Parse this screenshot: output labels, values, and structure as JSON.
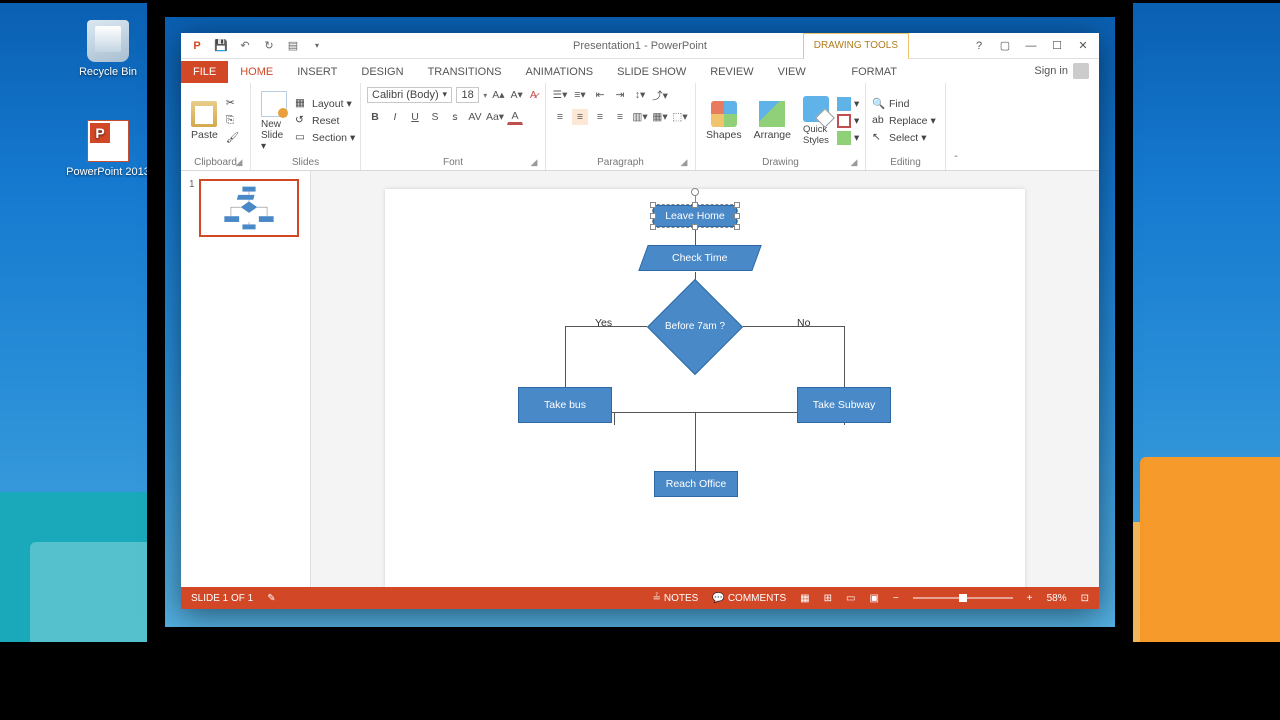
{
  "desktop": {
    "recycle": "Recycle Bin",
    "ppt": "PowerPoint 2013"
  },
  "titlebar": {
    "title": "Presentation1 - PowerPoint",
    "context": "DRAWING TOOLS",
    "signin": "Sign in"
  },
  "tabs": {
    "file": "FILE",
    "home": "HOME",
    "insert": "INSERT",
    "design": "DESIGN",
    "transitions": "TRANSITIONS",
    "animations": "ANIMATIONS",
    "slideshow": "SLIDE SHOW",
    "review": "REVIEW",
    "view": "VIEW",
    "format": "FORMAT"
  },
  "ribbon": {
    "clipboard": {
      "label": "Clipboard",
      "paste": "Paste"
    },
    "slides": {
      "label": "Slides",
      "new": "New Slide",
      "layout": "Layout",
      "reset": "Reset",
      "section": "Section"
    },
    "font": {
      "label": "Font",
      "name": "Calibri (Body)",
      "size": "18"
    },
    "paragraph": {
      "label": "Paragraph"
    },
    "drawing": {
      "label": "Drawing",
      "shapes": "Shapes",
      "arrange": "Arrange",
      "styles": "Quick Styles"
    },
    "editing": {
      "label": "Editing",
      "find": "Find",
      "replace": "Replace",
      "select": "Select"
    }
  },
  "flow": {
    "leave": "Leave Home",
    "check": "Check Time",
    "decision": "Before 7am ?",
    "yes": "Yes",
    "no": "No",
    "bus": "Take bus",
    "subway": "Take Subway",
    "reach": "Reach Office"
  },
  "status": {
    "slide": "SLIDE 1 OF 1",
    "notes": "NOTES",
    "comments": "COMMENTS",
    "zoom": "58%"
  },
  "chart_data": {
    "type": "flowchart",
    "nodes": [
      {
        "id": "leave",
        "type": "process",
        "label": "Leave Home"
      },
      {
        "id": "check",
        "type": "data",
        "label": "Check Time"
      },
      {
        "id": "decision",
        "type": "decision",
        "label": "Before 7am ?"
      },
      {
        "id": "bus",
        "type": "process",
        "label": "Take bus"
      },
      {
        "id": "subway",
        "type": "process",
        "label": "Take Subway"
      },
      {
        "id": "reach",
        "type": "process",
        "label": "Reach Office"
      }
    ],
    "edges": [
      {
        "from": "leave",
        "to": "check"
      },
      {
        "from": "check",
        "to": "decision"
      },
      {
        "from": "decision",
        "to": "bus",
        "label": "Yes"
      },
      {
        "from": "decision",
        "to": "subway",
        "label": "No"
      },
      {
        "from": "bus",
        "to": "reach"
      },
      {
        "from": "subway",
        "to": "reach"
      }
    ]
  }
}
